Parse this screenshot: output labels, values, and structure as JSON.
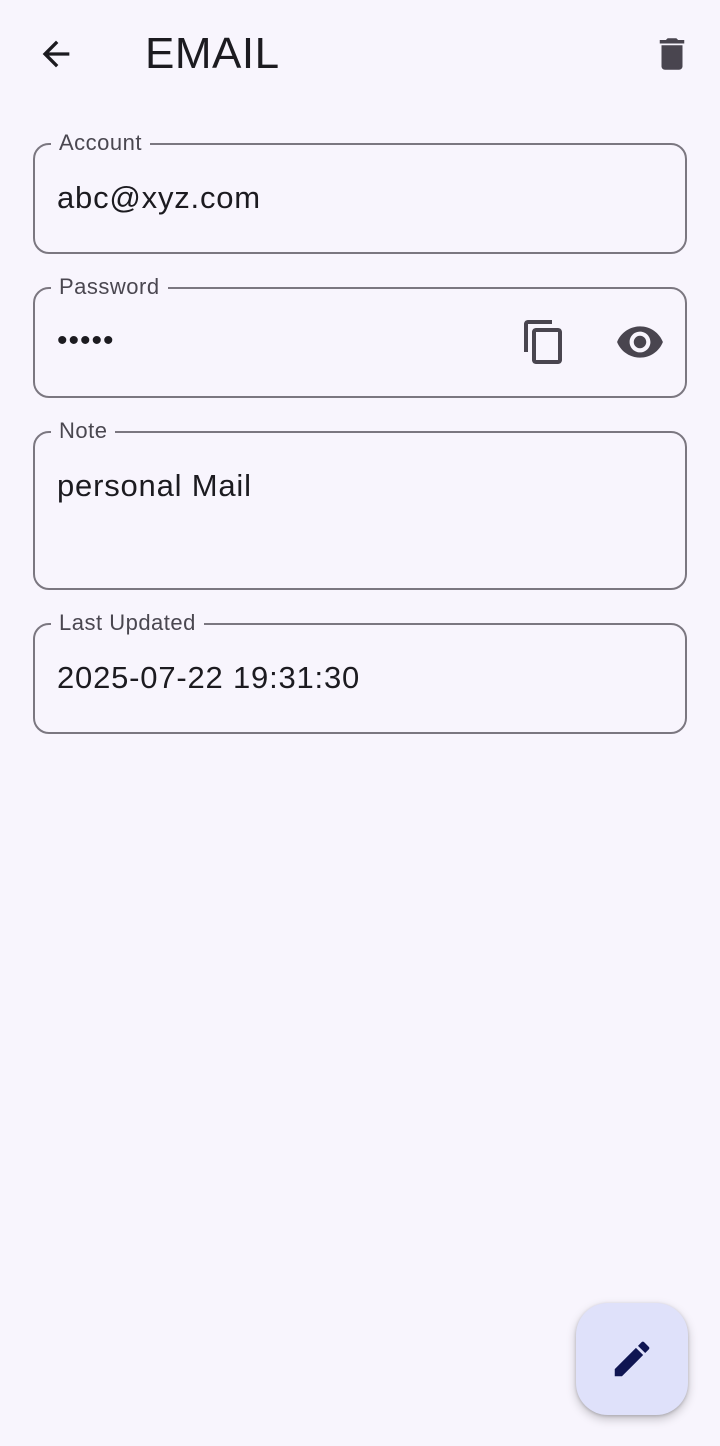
{
  "header": {
    "title": "EMAIL"
  },
  "fields": {
    "account": {
      "label": "Account",
      "value": "abc@xyz.com"
    },
    "password": {
      "label": "Password",
      "masked_value": "•••••"
    },
    "note": {
      "label": "Note",
      "value": "personal Mail"
    },
    "last_updated": {
      "label": "Last Updated",
      "value": "2025-07-22 19:31:30"
    }
  },
  "icons": {
    "back": "arrow-back-icon",
    "delete": "trash-icon",
    "copy": "copy-icon",
    "visibility": "eye-icon",
    "edit": "pencil-icon"
  },
  "colors": {
    "background": "#f8f5fd",
    "outline": "#7b7780",
    "icon": "#49454f",
    "fab_background": "#dfe1fa",
    "fab_icon": "#0f1552"
  }
}
